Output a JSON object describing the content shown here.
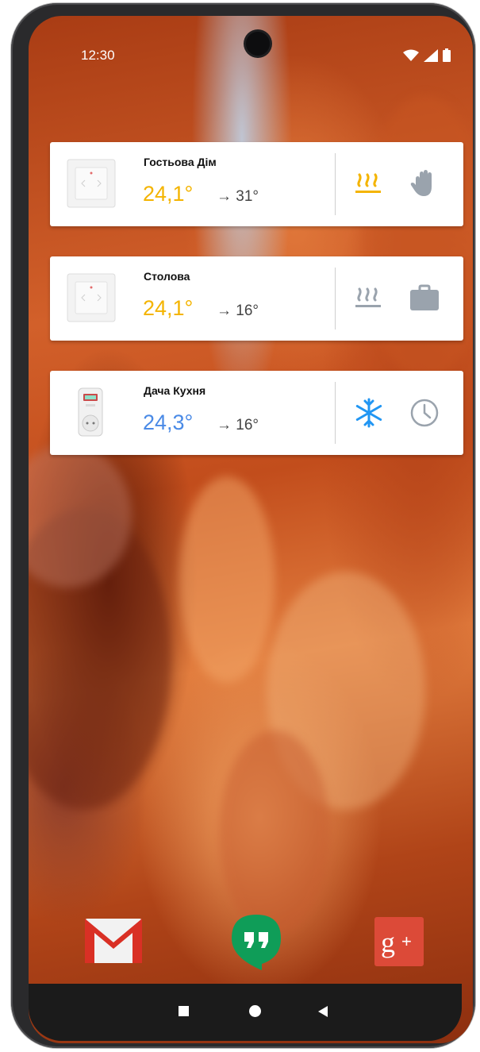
{
  "status_bar": {
    "time": "12:30",
    "icons": [
      "wifi-icon",
      "signal-icon",
      "battery-icon"
    ]
  },
  "widgets": [
    {
      "device": "wall-thermostat",
      "name": "Гостьова Дім",
      "current_temp": "24,1°",
      "target_temp": "→ 31°",
      "current_color": "#f4b400",
      "mode_icon": "heating-icon",
      "mode_active": true,
      "program_icon": "manual-hand-icon"
    },
    {
      "device": "wall-thermostat",
      "name": "Столова",
      "current_temp": "24,1°",
      "target_temp": "→ 16°",
      "current_color": "#f4b400",
      "mode_icon": "heating-icon",
      "mode_active": false,
      "program_icon": "away-briefcase-icon"
    },
    {
      "device": "socket-thermostat",
      "name": "Дача Кухня",
      "current_temp": "24,3°",
      "target_temp": "→ 16°",
      "current_color": "#4a8ae6",
      "mode_icon": "snowflake-icon",
      "mode_active": true,
      "program_icon": "schedule-clock-icon"
    }
  ],
  "dock": [
    "gmail-icon",
    "hangouts-icon",
    "google-plus-icon"
  ],
  "nav_bar": [
    "recents-button",
    "home-button",
    "back-button"
  ],
  "colors": {
    "heating_active": "#f4b400",
    "icon_inactive": "#9aa3ad",
    "cooling": "#2196f3"
  }
}
